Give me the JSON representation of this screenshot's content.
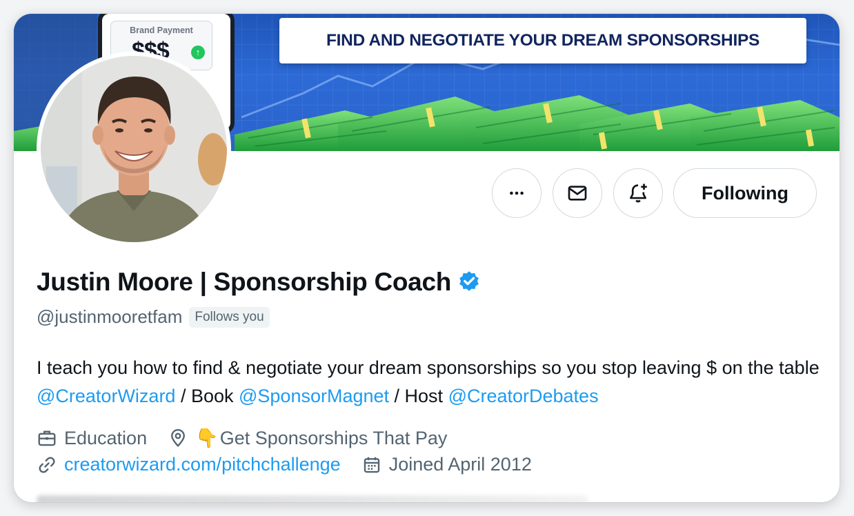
{
  "banner": {
    "headline": "FIND AND NEGOTIATE YOUR DREAM SPONSORSHIPS",
    "brand_payment_label": "Brand Payment",
    "brand_payment_value": "$$$"
  },
  "actions": {
    "more_icon": "more-horizontal-icon",
    "message_icon": "envelope-icon",
    "notify_icon": "bell-plus-icon",
    "following_label": "Following"
  },
  "profile": {
    "name": "Justin Moore | Sponsorship Coach",
    "verified": true,
    "handle": "@justinmooretfam",
    "follows_you": "Follows you",
    "bio": {
      "part1": "I teach you how to find & negotiate your dream sponsorships so you stop leaving $ on the table ",
      "mention1": "@CreatorWizard",
      "part2": " / Book ",
      "mention2": "@SponsorMagnet",
      "part3": " / Host ",
      "mention3": "@CreatorDebates"
    },
    "category": "Education",
    "location_emoji": "👇",
    "location": "Get Sponsorships That Pay",
    "website": "creatorwizard.com/pitchchallenge",
    "joined": "Joined April 2012"
  },
  "colors": {
    "accent": "#1d9bf0",
    "verified": "#1d9bf0",
    "secondary_text": "#536471",
    "border": "#cfd9de"
  }
}
